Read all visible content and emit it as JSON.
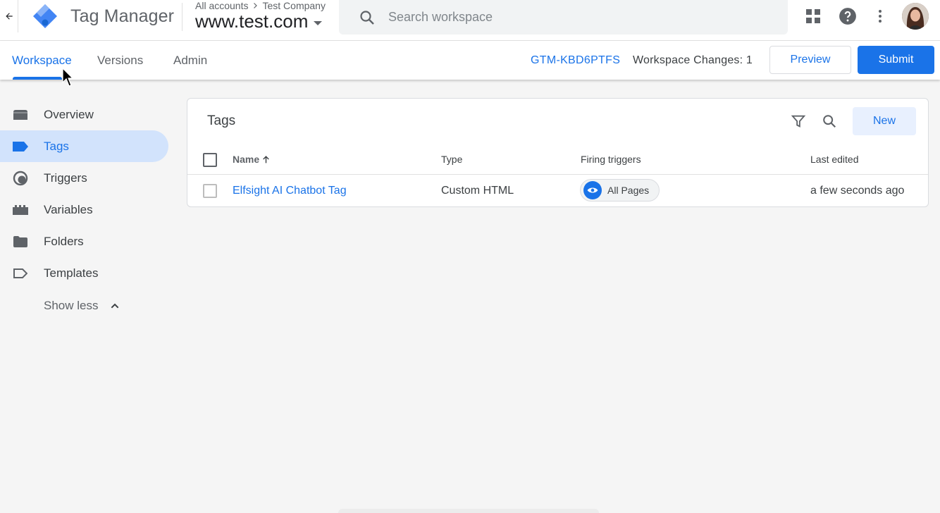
{
  "header": {
    "app_name": "Tag Manager",
    "breadcrumb": [
      "All accounts",
      "Test Company"
    ],
    "container_name": "www.test.com",
    "search_placeholder": "Search workspace"
  },
  "subbar": {
    "tabs": [
      {
        "label": "Workspace",
        "active": true
      },
      {
        "label": "Versions",
        "active": false
      },
      {
        "label": "Admin",
        "active": false
      }
    ],
    "container_id": "GTM-KBD6PTFS",
    "workspace_changes": "Workspace Changes: 1",
    "preview_label": "Preview",
    "submit_label": "Submit"
  },
  "sidebar": {
    "items": [
      {
        "label": "Overview",
        "icon": "overview-icon"
      },
      {
        "label": "Tags",
        "icon": "tag-icon",
        "active": true
      },
      {
        "label": "Triggers",
        "icon": "trigger-icon"
      },
      {
        "label": "Variables",
        "icon": "variables-icon"
      },
      {
        "label": "Folders",
        "icon": "folder-icon"
      },
      {
        "label": "Templates",
        "icon": "template-icon"
      }
    ],
    "show_less": "Show less"
  },
  "tags_card": {
    "title": "Tags",
    "new_label": "New",
    "columns": [
      "Name",
      "Type",
      "Firing triggers",
      "Last edited"
    ],
    "rows": [
      {
        "name": "Elfsight AI Chatbot Tag",
        "type": "Custom HTML",
        "trigger": "All Pages",
        "last_edited": "a few seconds ago"
      }
    ]
  },
  "colors": {
    "accent": "#1a73e8",
    "active_nav_bg": "#d2e3fc"
  }
}
